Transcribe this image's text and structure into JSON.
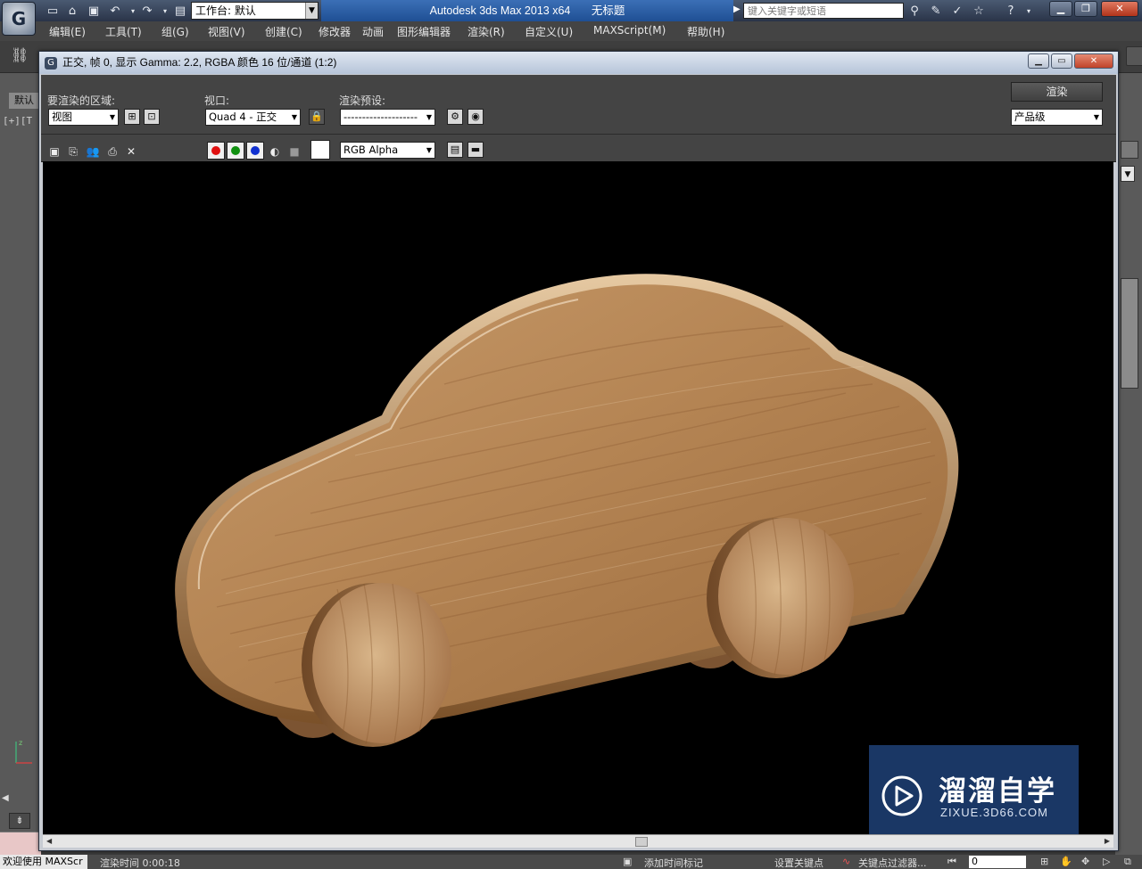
{
  "app": {
    "logo_glyph": "G",
    "title_product": "Autodesk 3ds Max  2013 x64",
    "title_document": "无标题",
    "workspace_label": "工作台: 默认",
    "search_placeholder": "键入关键字或短语",
    "icons": [
      "new-file-icon",
      "open-folder-icon",
      "save-icon",
      "undo-icon",
      "redo-icon",
      "project-folder-icon",
      "binoculars-icon",
      "key-icon",
      "star-icon",
      "help-icon"
    ]
  },
  "menu": {
    "items": [
      "编辑(E)",
      "工具(T)",
      "组(G)",
      "视图(V)",
      "创建(C)",
      "修改器",
      "动画",
      "图形编辑器",
      "渲染(R)",
      "自定义(U)",
      "MAXScript(M)",
      "帮助(H)"
    ]
  },
  "viewport": {
    "tab_label": "默认",
    "corner_label": "[+][T"
  },
  "render_window": {
    "title": "正交, 帧 0, 显示 Gamma: 2.2, RGBA 颜色 16 位/通道 (1:2)",
    "area_label": "要渲染的区域:",
    "area_value": "视图",
    "viewport_label": "视口:",
    "viewport_value": "Quad 4 - 正交",
    "preset_label": "渲染预设:",
    "preset_value": "--------------------",
    "render_button": "渲染",
    "quality_value": "产品级",
    "channel_value": "RGB Alpha",
    "channel_colors": {
      "red": "#e01010",
      "green": "#109010",
      "blue": "#1030d0"
    }
  },
  "status": {
    "welcome": "欢迎使用 MAXScr",
    "render_time": "渲染时间 0:00:18",
    "add_time_tag": "添加时间标记",
    "set_key": "设置关键点",
    "key_filter": "关键点过滤器...",
    "frame": "0"
  },
  "watermark": {
    "name": "溜溜自学",
    "url": "ZIXUE.3D66.COM"
  }
}
